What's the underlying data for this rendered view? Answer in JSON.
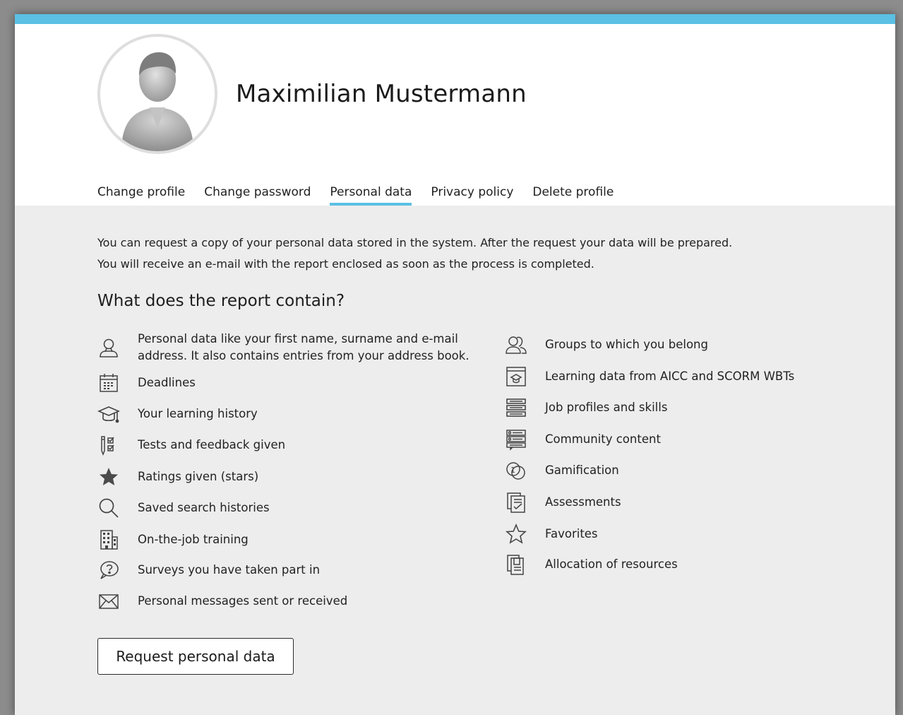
{
  "profile": {
    "name": "Maximilian Mustermann"
  },
  "tabs": [
    {
      "label": "Change profile",
      "active": false
    },
    {
      "label": "Change password",
      "active": false
    },
    {
      "label": "Personal data",
      "active": true
    },
    {
      "label": "Privacy policy",
      "active": false
    },
    {
      "label": "Delete profile",
      "active": false
    }
  ],
  "intro": [
    "You can request a copy of your personal data stored in the system. After the request your data will be prepared.",
    "You will receive an e-mail with the report enclosed as soon as the process is completed."
  ],
  "report": {
    "title": "What does the report contain?",
    "left": [
      {
        "icon": "user-icon",
        "text": "Personal data like your first name, surname and e-mail address. It also contains entries from your address book."
      },
      {
        "icon": "calendar-icon",
        "text": "Deadlines"
      },
      {
        "icon": "graduation-cap-icon",
        "text": "Your learning history"
      },
      {
        "icon": "tests-feedback-icon",
        "text": "Tests and feedback given"
      },
      {
        "icon": "star-filled-icon",
        "text": "Ratings given (stars)"
      },
      {
        "icon": "search-icon",
        "text": "Saved search histories"
      },
      {
        "icon": "building-icon",
        "text": "On-the-job training"
      },
      {
        "icon": "question-bubble-icon",
        "text": "Surveys you have taken part in"
      },
      {
        "icon": "envelope-icon",
        "text": "Personal messages sent or received"
      }
    ],
    "right": [
      {
        "icon": "group-icon",
        "text": "Groups to which you belong"
      },
      {
        "icon": "wbt-learning-icon",
        "text": "Learning data from AICC and SCORM WBTs"
      },
      {
        "icon": "job-profiles-icon",
        "text": "Job profiles and skills"
      },
      {
        "icon": "community-icon",
        "text": "Community content"
      },
      {
        "icon": "gamification-icon",
        "text": "Gamification"
      },
      {
        "icon": "assessments-icon",
        "text": "Assessments"
      },
      {
        "icon": "star-outline-icon",
        "text": "Favorites"
      },
      {
        "icon": "resources-icon",
        "text": "Allocation of resources"
      }
    ]
  },
  "actions": {
    "request_label": "Request personal data"
  },
  "colors": {
    "accent": "#5bc0e4",
    "panel": "#ededed",
    "header": "#ffffff"
  }
}
